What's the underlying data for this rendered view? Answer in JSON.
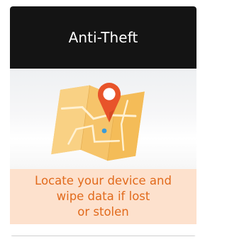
{
  "feature": {
    "title": "Anti-Theft",
    "description": "Locate your device and\nwipe data if lost\nor stolen",
    "icon": "map-location-pin-icon"
  },
  "colors": {
    "header_bg": "#141414",
    "header_text": "#ffffff",
    "footer_bg": "#fde1cd",
    "footer_text": "#e16a1c",
    "pin": "#e8542a",
    "map": "#f6c46a"
  }
}
